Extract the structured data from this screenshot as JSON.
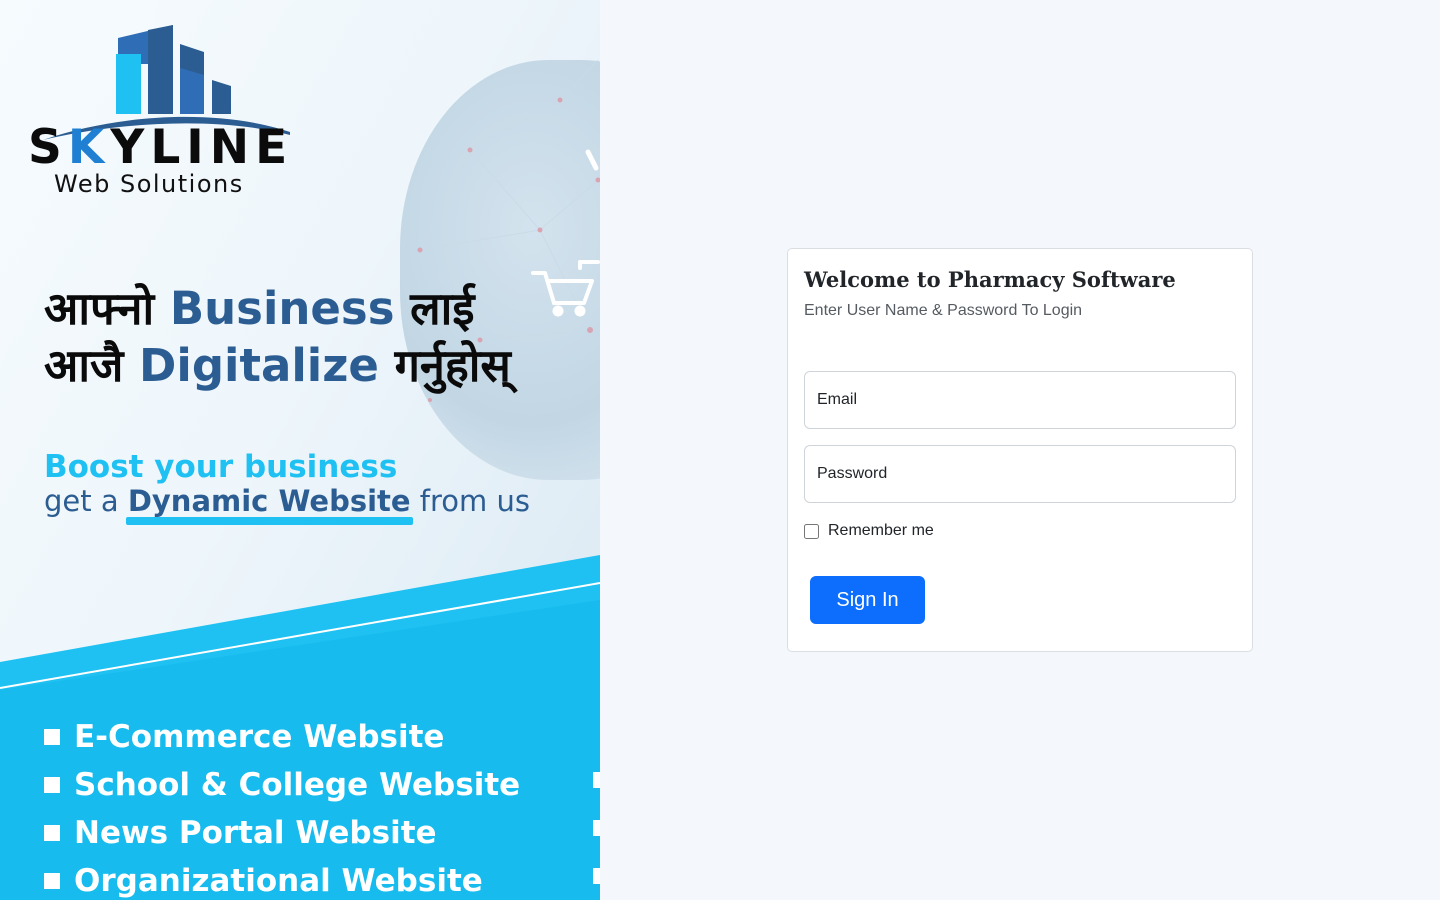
{
  "banner": {
    "logo": {
      "brand": "SKYLINE",
      "subtitle": "Web Solutions"
    },
    "tagline": {
      "line1_pre": "आफ्नो ",
      "line1_hl": "Business",
      "line1_post": " लाई",
      "line2_pre": "आजै ",
      "line2_hl": "Digitalize",
      "line2_post": " गर्नुहोस्"
    },
    "boost": "Boost your business",
    "get_line": {
      "pre": "get a ",
      "highlight": "Dynamic Website",
      "post": " from us"
    },
    "services": [
      "E-Commerce Website",
      "School & College Website",
      "News Portal Website",
      "Organizational Website"
    ]
  },
  "login": {
    "title": "Welcome to Pharmacy Software",
    "subtitle": "Enter User Name & Password To Login",
    "email_placeholder": "Email",
    "password_placeholder": "Password",
    "remember_label": "Remember me",
    "remember_checked": false,
    "submit_label": "Sign In"
  },
  "colors": {
    "accent": "#0d6efd",
    "brand_blue": "#2c5d92",
    "brand_cyan": "#1ec1f2",
    "page_background": "#f4f8fd"
  },
  "icons": [
    "building-logo-icon",
    "shopping-cart-icon",
    "square-bullet-icon"
  ]
}
